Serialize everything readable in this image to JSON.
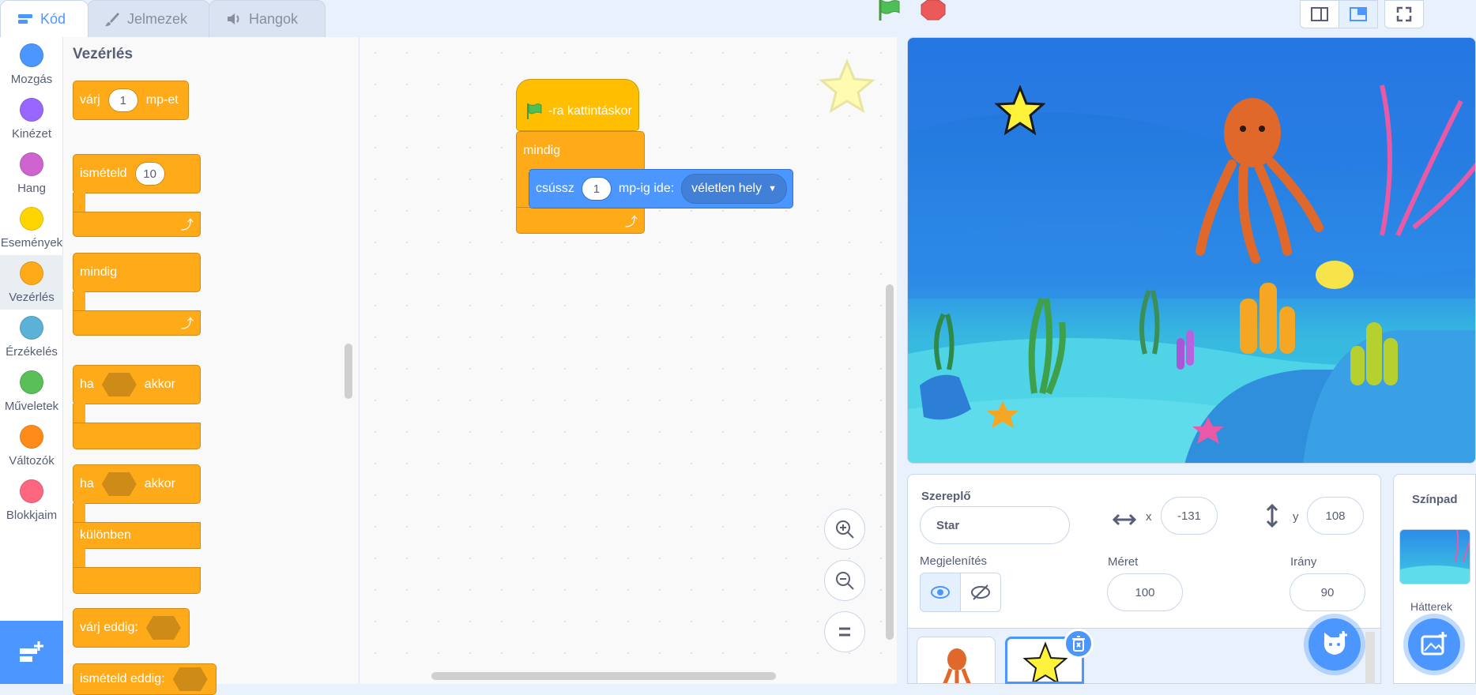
{
  "tabs": [
    {
      "label": "Kód"
    },
    {
      "label": "Jelmezek"
    },
    {
      "label": "Hangok"
    }
  ],
  "categories": [
    {
      "label": "Mozgás",
      "color": "#4c97ff"
    },
    {
      "label": "Kinézet",
      "color": "#9966ff"
    },
    {
      "label": "Hang",
      "color": "#cf63cf"
    },
    {
      "label": "Események",
      "color": "#ffd500"
    },
    {
      "label": "Vezérlés",
      "color": "#ffab19"
    },
    {
      "label": "Érzékelés",
      "color": "#5cb1d6"
    },
    {
      "label": "Műveletek",
      "color": "#59c059"
    },
    {
      "label": "Változók",
      "color": "#ff8c1a"
    },
    {
      "label": "Blokkjaim",
      "color": "#ff6680"
    }
  ],
  "palette": {
    "title": "Vezérlés",
    "wait": {
      "label": "várj",
      "value": "1",
      "suffix": "mp-et"
    },
    "repeat": {
      "label": "ismételd",
      "value": "10"
    },
    "forever": {
      "label": "mindig"
    },
    "if": {
      "label": "ha",
      "suffix": "akkor"
    },
    "ifelse": {
      "label": "ha",
      "suffix": "akkor",
      "else": "különben"
    },
    "waituntil": {
      "label": "várj eddig:"
    },
    "repeatuntil": {
      "label": "ismételd eddig:"
    }
  },
  "script": {
    "hat": "-ra kattintáskor",
    "forever": "mindig",
    "glide": {
      "label": "csússz",
      "value": "1",
      "mid": "mp-ig ide:",
      "target": "véletlen hely"
    }
  },
  "sprite": {
    "label": "Szereplő",
    "name": "Star",
    "x_label": "x",
    "x": "-131",
    "y_label": "y",
    "y": "108",
    "show_label": "Megjelenítés",
    "size_label": "Méret",
    "size": "100",
    "dir_label": "Irány",
    "dir": "90"
  },
  "stage_panel": {
    "title": "Színpad",
    "backdrops_label": "Hátterek"
  },
  "colors": {
    "accent": "#4c97ff",
    "control": "#ffab19",
    "events": "#ffbf00"
  }
}
